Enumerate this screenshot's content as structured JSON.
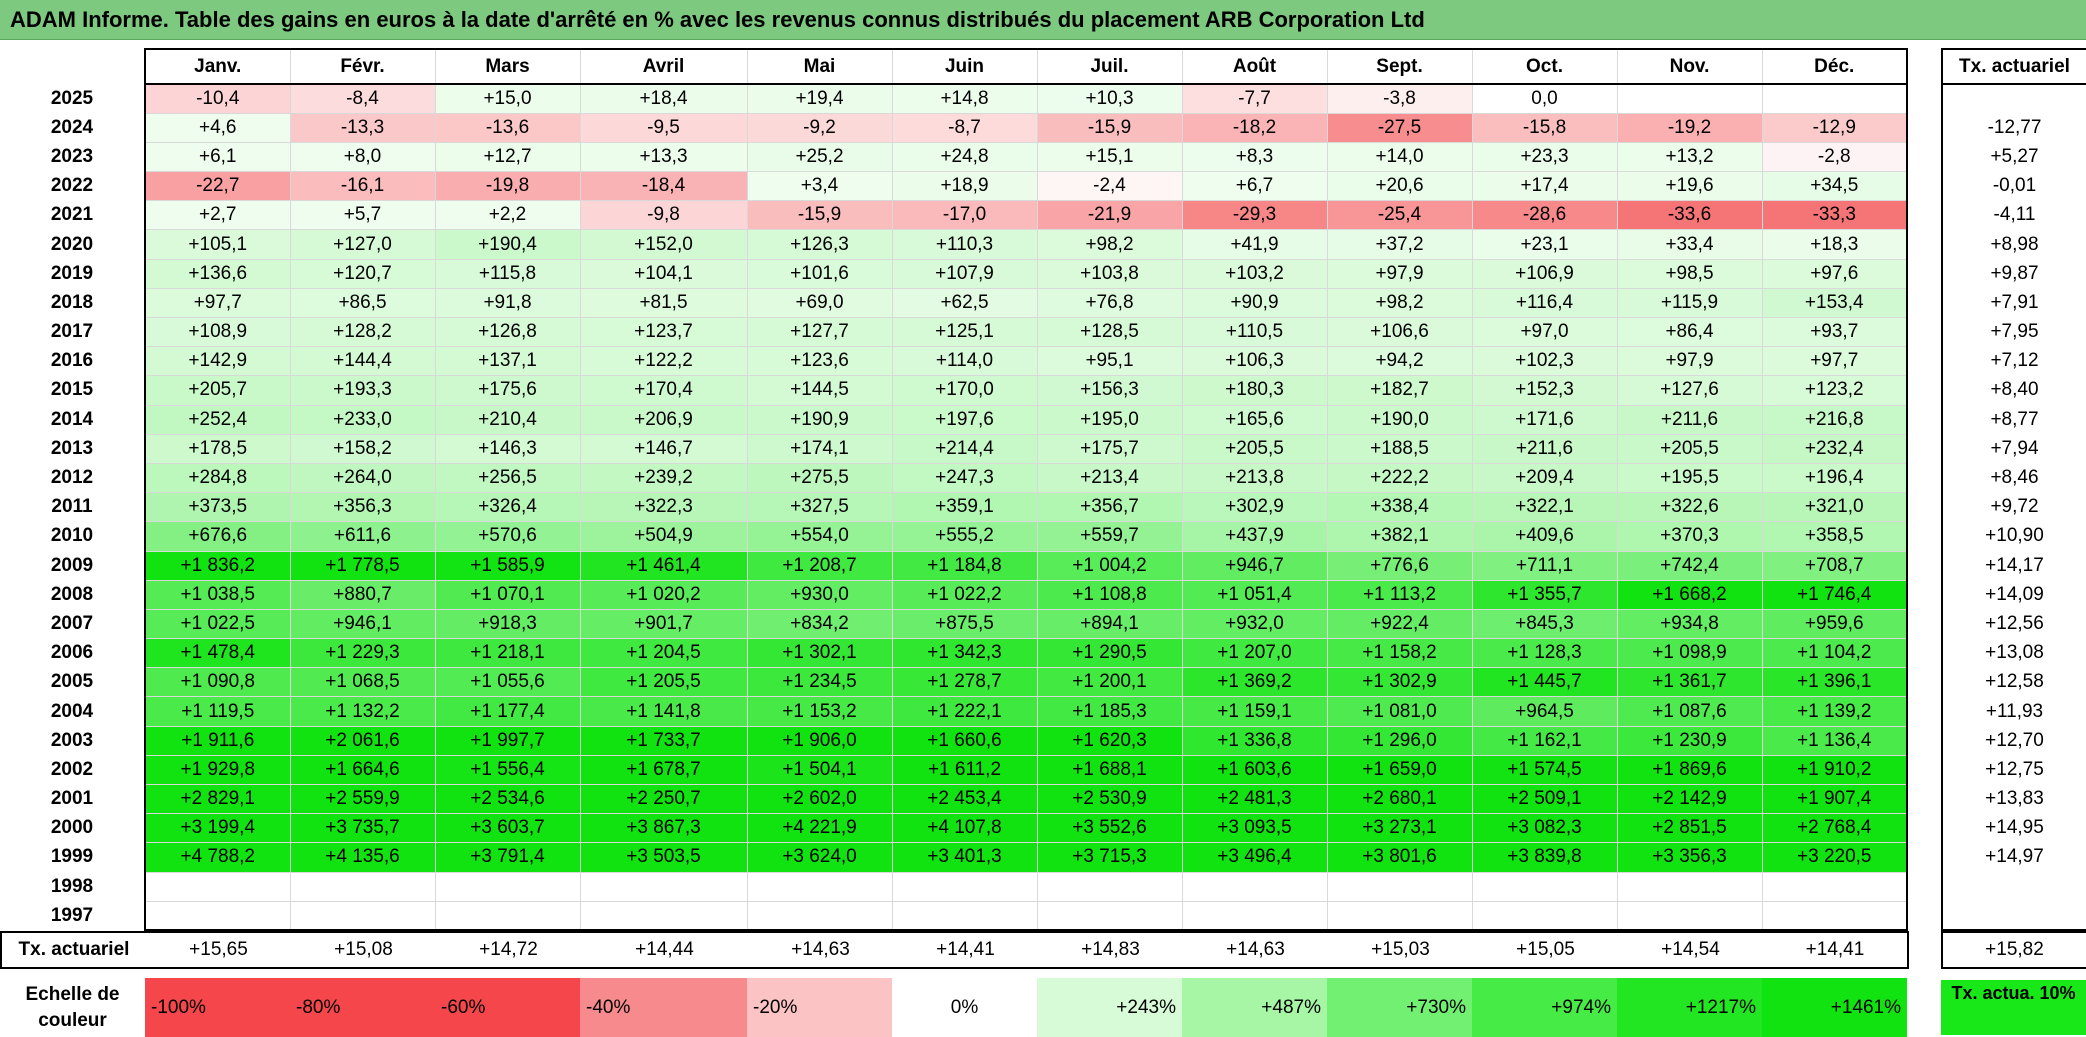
{
  "title": "ADAM Informe. Table des gains en euros à la date d'arrêté en % avec les revenus connus distribués du placement ARB Corporation Ltd",
  "chart_data": {
    "type": "table",
    "title": "ADAM Informe. Table des gains en euros à la date d'arrêté en % avec les revenus connus distribués du placement ARB Corporation Ltd",
    "columns": [
      "Janv.",
      "Févr.",
      "Mars",
      "Avril",
      "Mai",
      "Juin",
      "Juil.",
      "Août",
      "Sept.",
      "Oct.",
      "Nov.",
      "Déc."
    ],
    "right_header": "Tx. actuariel",
    "rows": [
      {
        "year": "2025",
        "values": [
          "-10,4",
          "-8,4",
          "+15,0",
          "+18,4",
          "+19,4",
          "+14,8",
          "+10,3",
          "-7,7",
          "-3,8",
          "0,0",
          "",
          ""
        ],
        "tx": ""
      },
      {
        "year": "2024",
        "values": [
          "+4,6",
          "-13,3",
          "-13,6",
          "-9,5",
          "-9,2",
          "-8,7",
          "-15,9",
          "-18,2",
          "-27,5",
          "-15,8",
          "-19,2",
          "-12,9"
        ],
        "tx": "-12,77"
      },
      {
        "year": "2023",
        "values": [
          "+6,1",
          "+8,0",
          "+12,7",
          "+13,3",
          "+25,2",
          "+24,8",
          "+15,1",
          "+8,3",
          "+14,0",
          "+23,3",
          "+13,2",
          "-2,8"
        ],
        "tx": "+5,27"
      },
      {
        "year": "2022",
        "values": [
          "-22,7",
          "-16,1",
          "-19,8",
          "-18,4",
          "+3,4",
          "+18,9",
          "-2,4",
          "+6,7",
          "+20,6",
          "+17,4",
          "+19,6",
          "+34,5"
        ],
        "tx": "-0,01"
      },
      {
        "year": "2021",
        "values": [
          "+2,7",
          "+5,7",
          "+2,2",
          "-9,8",
          "-15,9",
          "-17,0",
          "-21,9",
          "-29,3",
          "-25,4",
          "-28,6",
          "-33,6",
          "-33,3"
        ],
        "tx": "-4,11"
      },
      {
        "year": "2020",
        "values": [
          "+105,1",
          "+127,0",
          "+190,4",
          "+152,0",
          "+126,3",
          "+110,3",
          "+98,2",
          "+41,9",
          "+37,2",
          "+23,1",
          "+33,4",
          "+18,3"
        ],
        "tx": "+8,98"
      },
      {
        "year": "2019",
        "values": [
          "+136,6",
          "+120,7",
          "+115,8",
          "+104,1",
          "+101,6",
          "+107,9",
          "+103,8",
          "+103,2",
          "+97,9",
          "+106,9",
          "+98,5",
          "+97,6"
        ],
        "tx": "+9,87"
      },
      {
        "year": "2018",
        "values": [
          "+97,7",
          "+86,5",
          "+91,8",
          "+81,5",
          "+69,0",
          "+62,5",
          "+76,8",
          "+90,9",
          "+98,2",
          "+116,4",
          "+115,9",
          "+153,4"
        ],
        "tx": "+7,91"
      },
      {
        "year": "2017",
        "values": [
          "+108,9",
          "+128,2",
          "+126,8",
          "+123,7",
          "+127,7",
          "+125,1",
          "+128,5",
          "+110,5",
          "+106,6",
          "+97,0",
          "+86,4",
          "+93,7"
        ],
        "tx": "+7,95"
      },
      {
        "year": "2016",
        "values": [
          "+142,9",
          "+144,4",
          "+137,1",
          "+122,2",
          "+123,6",
          "+114,0",
          "+95,1",
          "+106,3",
          "+94,2",
          "+102,3",
          "+97,9",
          "+97,7"
        ],
        "tx": "+7,12"
      },
      {
        "year": "2015",
        "values": [
          "+205,7",
          "+193,3",
          "+175,6",
          "+170,4",
          "+144,5",
          "+170,0",
          "+156,3",
          "+180,3",
          "+182,7",
          "+152,3",
          "+127,6",
          "+123,2"
        ],
        "tx": "+8,40"
      },
      {
        "year": "2014",
        "values": [
          "+252,4",
          "+233,0",
          "+210,4",
          "+206,9",
          "+190,9",
          "+197,6",
          "+195,0",
          "+165,6",
          "+190,0",
          "+171,6",
          "+211,6",
          "+216,8"
        ],
        "tx": "+8,77"
      },
      {
        "year": "2013",
        "values": [
          "+178,5",
          "+158,2",
          "+146,3",
          "+146,7",
          "+174,1",
          "+214,4",
          "+175,7",
          "+205,5",
          "+188,5",
          "+211,6",
          "+205,5",
          "+232,4"
        ],
        "tx": "+7,94"
      },
      {
        "year": "2012",
        "values": [
          "+284,8",
          "+264,0",
          "+256,5",
          "+239,2",
          "+275,5",
          "+247,3",
          "+213,4",
          "+213,8",
          "+222,2",
          "+209,4",
          "+195,5",
          "+196,4"
        ],
        "tx": "+8,46"
      },
      {
        "year": "2011",
        "values": [
          "+373,5",
          "+356,3",
          "+326,4",
          "+322,3",
          "+327,5",
          "+359,1",
          "+356,7",
          "+302,9",
          "+338,4",
          "+322,1",
          "+322,6",
          "+321,0"
        ],
        "tx": "+9,72"
      },
      {
        "year": "2010",
        "values": [
          "+676,6",
          "+611,6",
          "+570,6",
          "+504,9",
          "+554,0",
          "+555,2",
          "+559,7",
          "+437,9",
          "+382,1",
          "+409,6",
          "+370,3",
          "+358,5"
        ],
        "tx": "+10,90"
      },
      {
        "year": "2009",
        "values": [
          "+1 836,2",
          "+1 778,5",
          "+1 585,9",
          "+1 461,4",
          "+1 208,7",
          "+1 184,8",
          "+1 004,2",
          "+946,7",
          "+776,6",
          "+711,1",
          "+742,4",
          "+708,7"
        ],
        "tx": "+14,17"
      },
      {
        "year": "2008",
        "values": [
          "+1 038,5",
          "+880,7",
          "+1 070,1",
          "+1 020,2",
          "+930,0",
          "+1 022,2",
          "+1 108,8",
          "+1 051,4",
          "+1 113,2",
          "+1 355,7",
          "+1 668,2",
          "+1 746,4"
        ],
        "tx": "+14,09"
      },
      {
        "year": "2007",
        "values": [
          "+1 022,5",
          "+946,1",
          "+918,3",
          "+901,7",
          "+834,2",
          "+875,5",
          "+894,1",
          "+932,0",
          "+922,4",
          "+845,3",
          "+934,8",
          "+959,6"
        ],
        "tx": "+12,56"
      },
      {
        "year": "2006",
        "values": [
          "+1 478,4",
          "+1 229,3",
          "+1 218,1",
          "+1 204,5",
          "+1 302,1",
          "+1 342,3",
          "+1 290,5",
          "+1 207,0",
          "+1 158,2",
          "+1 128,3",
          "+1 098,9",
          "+1 104,2"
        ],
        "tx": "+13,08"
      },
      {
        "year": "2005",
        "values": [
          "+1 090,8",
          "+1 068,5",
          "+1 055,6",
          "+1 205,5",
          "+1 234,5",
          "+1 278,7",
          "+1 200,1",
          "+1 369,2",
          "+1 302,9",
          "+1 445,7",
          "+1 361,7",
          "+1 396,1"
        ],
        "tx": "+12,58"
      },
      {
        "year": "2004",
        "values": [
          "+1 119,5",
          "+1 132,2",
          "+1 177,4",
          "+1 141,8",
          "+1 153,2",
          "+1 222,1",
          "+1 185,3",
          "+1 159,1",
          "+1 081,0",
          "+964,5",
          "+1 087,6",
          "+1 139,2"
        ],
        "tx": "+11,93"
      },
      {
        "year": "2003",
        "values": [
          "+1 911,6",
          "+2 061,6",
          "+1 997,7",
          "+1 733,7",
          "+1 906,0",
          "+1 660,6",
          "+1 620,3",
          "+1 336,8",
          "+1 296,0",
          "+1 162,1",
          "+1 230,9",
          "+1 136,4"
        ],
        "tx": "+12,70"
      },
      {
        "year": "2002",
        "values": [
          "+1 929,8",
          "+1 664,6",
          "+1 556,4",
          "+1 678,7",
          "+1 504,1",
          "+1 611,2",
          "+1 688,1",
          "+1 603,6",
          "+1 659,0",
          "+1 574,5",
          "+1 869,6",
          "+1 910,2"
        ],
        "tx": "+12,75"
      },
      {
        "year": "2001",
        "values": [
          "+2 829,1",
          "+2 559,9",
          "+2 534,6",
          "+2 250,7",
          "+2 602,0",
          "+2 453,4",
          "+2 530,9",
          "+2 481,3",
          "+2 680,1",
          "+2 509,1",
          "+2 142,9",
          "+1 907,4"
        ],
        "tx": "+13,83"
      },
      {
        "year": "2000",
        "values": [
          "+3 199,4",
          "+3 735,7",
          "+3 603,7",
          "+3 867,3",
          "+4 221,9",
          "+4 107,8",
          "+3 552,6",
          "+3 093,5",
          "+3 273,1",
          "+3 082,3",
          "+2 851,5",
          "+2 768,4"
        ],
        "tx": "+14,95"
      },
      {
        "year": "1999",
        "values": [
          "+4 788,2",
          "+4 135,6",
          "+3 791,4",
          "+3 503,5",
          "+3 624,0",
          "+3 401,3",
          "+3 715,3",
          "+3 496,4",
          "+3 801,6",
          "+3 839,8",
          "+3 356,3",
          "+3 220,5"
        ],
        "tx": "+14,97"
      },
      {
        "year": "1998",
        "values": [
          "",
          "",
          "",
          "",
          "",
          "",
          "",
          "",
          "",
          "",
          "",
          ""
        ],
        "tx": ""
      },
      {
        "year": "1997",
        "values": [
          "",
          "",
          "",
          "",
          "",
          "",
          "",
          "",
          "",
          "",
          "",
          ""
        ],
        "tx": ""
      }
    ],
    "summary_label": "Tx. actuariel",
    "summary_values": [
      "+15,65",
      "+15,08",
      "+14,72",
      "+14,44",
      "+14,63",
      "+14,41",
      "+14,83",
      "+14,63",
      "+15,03",
      "+15,05",
      "+14,54",
      "+14,41"
    ],
    "summary_total": "+15,82",
    "scale_label": "Echelle de couleur",
    "scale": [
      {
        "label": "-100%",
        "color": "#f5474b"
      },
      {
        "label": "-80%",
        "color": "#f5474b"
      },
      {
        "label": "-60%",
        "color": "#f5474b"
      },
      {
        "label": "-40%",
        "color": "#f78a8c"
      },
      {
        "label": "-20%",
        "color": "#fbc3c4"
      },
      {
        "label": "0%",
        "color": "#ffffff"
      },
      {
        "label": "+243%",
        "color": "#d6fbd6"
      },
      {
        "label": "+487%",
        "color": "#a6f6a6"
      },
      {
        "label": "+730%",
        "color": "#72f072"
      },
      {
        "label": "+974%",
        "color": "#46eb46"
      },
      {
        "label": "+1217%",
        "color": "#22e622"
      },
      {
        "label": "+1461%",
        "color": "#10e310"
      }
    ],
    "legend_box": "Tx. actua. 10%",
    "legend_box_color": "#18e818"
  }
}
